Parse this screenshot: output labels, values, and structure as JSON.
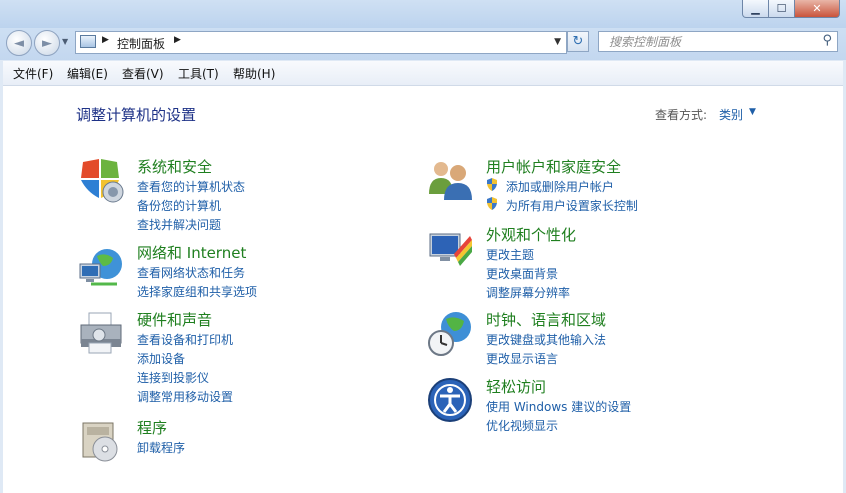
{
  "window": {
    "min_glyph": "▁",
    "max_glyph": "☐",
    "close_glyph": "✕"
  },
  "nav": {
    "back_glyph": "◄",
    "forward_glyph": "►",
    "dropdown_glyph": "▼",
    "breadcrumb_sep": "▶",
    "breadcrumb": "控制面板",
    "refresh_glyph": "↻",
    "search_placeholder": "搜索控制面板",
    "search_glyph": "⚲"
  },
  "menu": [
    "文件(F)",
    "编辑(E)",
    "查看(V)",
    "工具(T)",
    "帮助(H)"
  ],
  "page": {
    "title": "调整计算机的设置",
    "view_by_label": "查看方式:",
    "view_by_value": "类别",
    "view_by_arrow": "▼"
  },
  "categories": [
    {
      "title": "系统和安全",
      "icon": "shield-icon",
      "links": [
        "查看您的计算机状态",
        "备份您的计算机",
        "查找并解决问题"
      ]
    },
    {
      "title": "网络和 Internet",
      "icon": "network-icon",
      "links": [
        "查看网络状态和任务",
        "选择家庭组和共享选项"
      ]
    },
    {
      "title": "硬件和声音",
      "icon": "printer-icon",
      "links": [
        "查看设备和打印机",
        "添加设备",
        "连接到投影仪",
        "调整常用移动设置"
      ]
    },
    {
      "title": "程序",
      "icon": "programs-icon",
      "links": [
        "卸载程序"
      ]
    },
    {
      "title": "用户帐户和家庭安全",
      "icon": "users-icon",
      "links": [
        "添加或删除用户帐户",
        "为所有用户设置家长控制"
      ]
    },
    {
      "title": "外观和个性化",
      "icon": "appearance-icon",
      "links": [
        "更改主题",
        "更改桌面背景",
        "调整屏幕分辨率"
      ]
    },
    {
      "title": "时钟、语言和区域",
      "icon": "clock-globe-icon",
      "links": [
        "更改键盘或其他输入法",
        "更改显示语言"
      ]
    },
    {
      "title": "轻松访问",
      "icon": "ease-of-access-icon",
      "links": [
        "使用 Windows 建议的设置",
        "优化视频显示"
      ]
    }
  ],
  "colors": {
    "category_title": "#1f7f1f",
    "link": "#1f5fa8",
    "page_title": "#1e3287"
  }
}
